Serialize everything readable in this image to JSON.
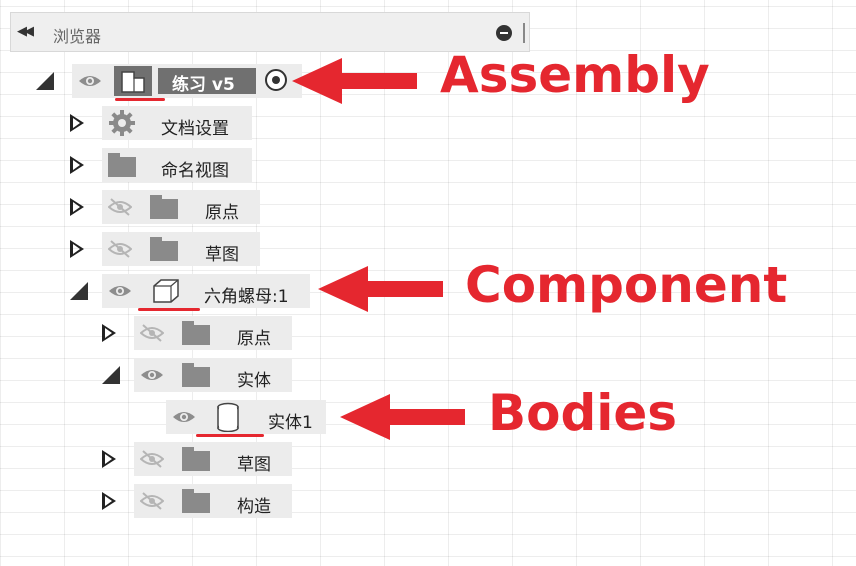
{
  "browser": {
    "title": "浏览器"
  },
  "tree": {
    "assembly": {
      "label": "练习 v5"
    },
    "document_settings": "文档设置",
    "named_views": "命名视图",
    "origin_top": "原点",
    "sketches_top": "草图",
    "component": {
      "label": "六角螺母:1"
    },
    "origin_component": "原点",
    "bodies_folder": "实体",
    "body_item": "实体1",
    "sketches_component": "草图",
    "construction": "构造"
  },
  "callouts": {
    "assembly": "Assembly",
    "component": "Component",
    "bodies": "Bodies"
  },
  "colors": {
    "accent": "#e5272f",
    "selected": "#707070",
    "row": "#ececec"
  }
}
